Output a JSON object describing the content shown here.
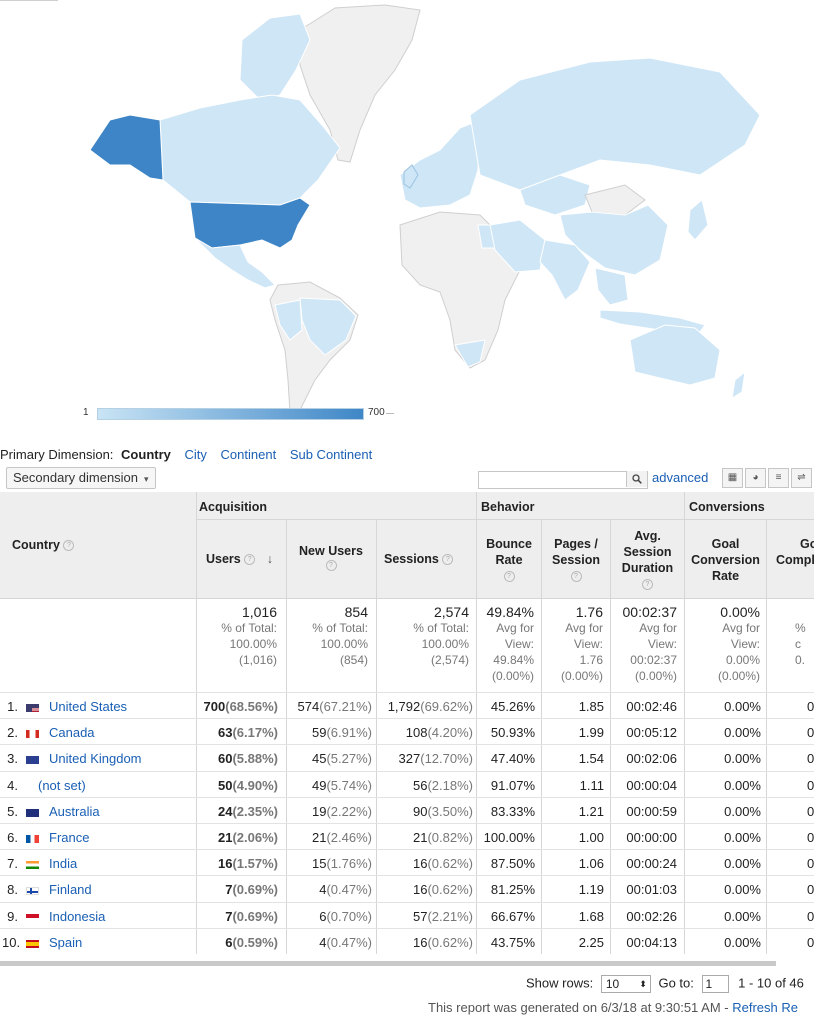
{
  "map": {
    "legend_min": "1",
    "legend_max": "700",
    "color_low": "#cfe6f6",
    "color_high": "#3d85c6"
  },
  "dimensions": {
    "primary_label": "Primary Dimension:",
    "active": "Country",
    "options": [
      "City",
      "Continent",
      "Sub Continent"
    ],
    "secondary_label": "Secondary dimension",
    "advanced": "advanced"
  },
  "table": {
    "col_country": "Country",
    "group_acquisition": "Acquisition",
    "group_behavior": "Behavior",
    "group_conversions": "Conversions",
    "col_users": "Users",
    "col_new_users": "New Users",
    "col_sessions": "Sessions",
    "col_bounce": [
      "Bounce",
      "Rate"
    ],
    "col_pages": [
      "Pages /",
      "Session"
    ],
    "col_duration": [
      "Avg.",
      "Session",
      "Duration"
    ],
    "col_goal": [
      "Goal",
      "Conversion",
      "Rate"
    ],
    "col_goal2": [
      "Go",
      "Compl"
    ],
    "totals": {
      "users": "1,016",
      "users_sub": [
        "% of Total:",
        "100.00%",
        "(1,016)"
      ],
      "new_users": "854",
      "new_users_sub": [
        "% of Total:",
        "100.00%",
        "(854)"
      ],
      "sessions": "2,574",
      "sessions_sub": [
        "% of Total:",
        "100.00%",
        "(2,574)"
      ],
      "bounce": "49.84%",
      "bounce_sub": [
        "Avg for",
        "View:",
        "49.84%",
        "(0.00%)"
      ],
      "pages": "1.76",
      "pages_sub": [
        "Avg for",
        "View:",
        "1.76",
        "(0.00%)"
      ],
      "duration": "00:02:37",
      "duration_sub": [
        "Avg for",
        "View:",
        "00:02:37",
        "(0.00%)"
      ],
      "goal": "0.00%",
      "goal_sub": [
        "Avg for",
        "View:",
        "0.00%",
        "(0.00%)"
      ],
      "last_sub": [
        "% c",
        "0."
      ]
    },
    "rows": [
      {
        "idx": "1.",
        "country": "United States",
        "flag": "us",
        "users": "700",
        "users_pct": "(68.56%)",
        "new": "574",
        "new_pct": "(67.21%)",
        "sessions": "1,792",
        "sessions_pct": "(69.62%)",
        "bounce": "45.26%",
        "pages": "1.85",
        "dur": "00:02:46",
        "goal": "0.00%",
        "last": "0"
      },
      {
        "idx": "2.",
        "country": "Canada",
        "flag": "ca",
        "users": "63",
        "users_pct": "(6.17%)",
        "new": "59",
        "new_pct": "(6.91%)",
        "sessions": "108",
        "sessions_pct": "(4.20%)",
        "bounce": "50.93%",
        "pages": "1.99",
        "dur": "00:05:12",
        "goal": "0.00%",
        "last": "0"
      },
      {
        "idx": "3.",
        "country": "United Kingdom",
        "flag": "gb",
        "users": "60",
        "users_pct": "(5.88%)",
        "new": "45",
        "new_pct": "(5.27%)",
        "sessions": "327",
        "sessions_pct": "(12.70%)",
        "bounce": "47.40%",
        "pages": "1.54",
        "dur": "00:02:06",
        "goal": "0.00%",
        "last": "0"
      },
      {
        "idx": "4.",
        "country": "(not set)",
        "flag": "",
        "users": "50",
        "users_pct": "(4.90%)",
        "new": "49",
        "new_pct": "(5.74%)",
        "sessions": "56",
        "sessions_pct": "(2.18%)",
        "bounce": "91.07%",
        "pages": "1.11",
        "dur": "00:00:04",
        "goal": "0.00%",
        "last": "0"
      },
      {
        "idx": "5.",
        "country": "Australia",
        "flag": "au",
        "users": "24",
        "users_pct": "(2.35%)",
        "new": "19",
        "new_pct": "(2.22%)",
        "sessions": "90",
        "sessions_pct": "(3.50%)",
        "bounce": "83.33%",
        "pages": "1.21",
        "dur": "00:00:59",
        "goal": "0.00%",
        "last": "0"
      },
      {
        "idx": "6.",
        "country": "France",
        "flag": "fr",
        "users": "21",
        "users_pct": "(2.06%)",
        "new": "21",
        "new_pct": "(2.46%)",
        "sessions": "21",
        "sessions_pct": "(0.82%)",
        "bounce": "100.00%",
        "pages": "1.00",
        "dur": "00:00:00",
        "goal": "0.00%",
        "last": "0"
      },
      {
        "idx": "7.",
        "country": "India",
        "flag": "in",
        "users": "16",
        "users_pct": "(1.57%)",
        "new": "15",
        "new_pct": "(1.76%)",
        "sessions": "16",
        "sessions_pct": "(0.62%)",
        "bounce": "87.50%",
        "pages": "1.06",
        "dur": "00:00:24",
        "goal": "0.00%",
        "last": "0"
      },
      {
        "idx": "8.",
        "country": "Finland",
        "flag": "fi",
        "users": "7",
        "users_pct": "(0.69%)",
        "new": "4",
        "new_pct": "(0.47%)",
        "sessions": "16",
        "sessions_pct": "(0.62%)",
        "bounce": "81.25%",
        "pages": "1.19",
        "dur": "00:01:03",
        "goal": "0.00%",
        "last": "0"
      },
      {
        "idx": "9.",
        "country": "Indonesia",
        "flag": "id",
        "users": "7",
        "users_pct": "(0.69%)",
        "new": "6",
        "new_pct": "(0.70%)",
        "sessions": "57",
        "sessions_pct": "(2.21%)",
        "bounce": "66.67%",
        "pages": "1.68",
        "dur": "00:02:26",
        "goal": "0.00%",
        "last": "0"
      },
      {
        "idx": "10.",
        "country": "Spain",
        "flag": "es",
        "users": "6",
        "users_pct": "(0.59%)",
        "new": "4",
        "new_pct": "(0.47%)",
        "sessions": "16",
        "sessions_pct": "(0.62%)",
        "bounce": "43.75%",
        "pages": "2.25",
        "dur": "00:04:13",
        "goal": "0.00%",
        "last": "0"
      }
    ]
  },
  "pager": {
    "show_rows_label": "Show rows:",
    "show_rows_value": "10",
    "goto_label": "Go to:",
    "goto_value": "1",
    "range": "1 - 10 of 46"
  },
  "footer": {
    "generated": "This report was generated on 6/3/18 at 9:30:51 AM - ",
    "refresh": "Refresh Re"
  }
}
